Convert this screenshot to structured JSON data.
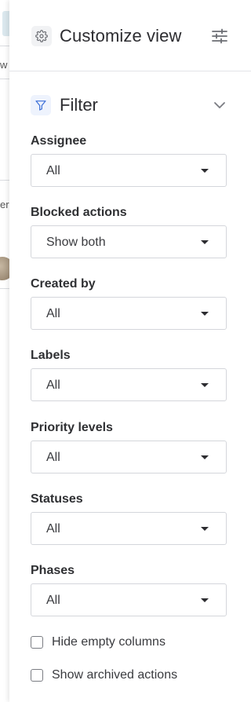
{
  "background": {
    "fragments": [
      "w",
      "er"
    ]
  },
  "panel": {
    "title": "Customize view",
    "header_icon": "gear-icon",
    "menu_icon": "sliders-icon"
  },
  "filter": {
    "title": "Filter",
    "icon": "filter-icon",
    "collapse_icon": "chevron-down-icon",
    "fields": [
      {
        "label": "Assignee",
        "value": "All"
      },
      {
        "label": "Blocked actions",
        "value": "Show both"
      },
      {
        "label": "Created by",
        "value": "All"
      },
      {
        "label": "Labels",
        "value": "All"
      },
      {
        "label": "Priority levels",
        "value": "All"
      },
      {
        "label": "Statuses",
        "value": "All"
      },
      {
        "label": "Phases",
        "value": "All"
      }
    ],
    "checkboxes": [
      {
        "label": "Hide empty columns",
        "checked": false
      },
      {
        "label": "Show archived actions",
        "checked": false
      }
    ]
  },
  "colors": {
    "accent": "#3b6fd8",
    "border": "#d4d6db",
    "text": "#2c2c30"
  }
}
